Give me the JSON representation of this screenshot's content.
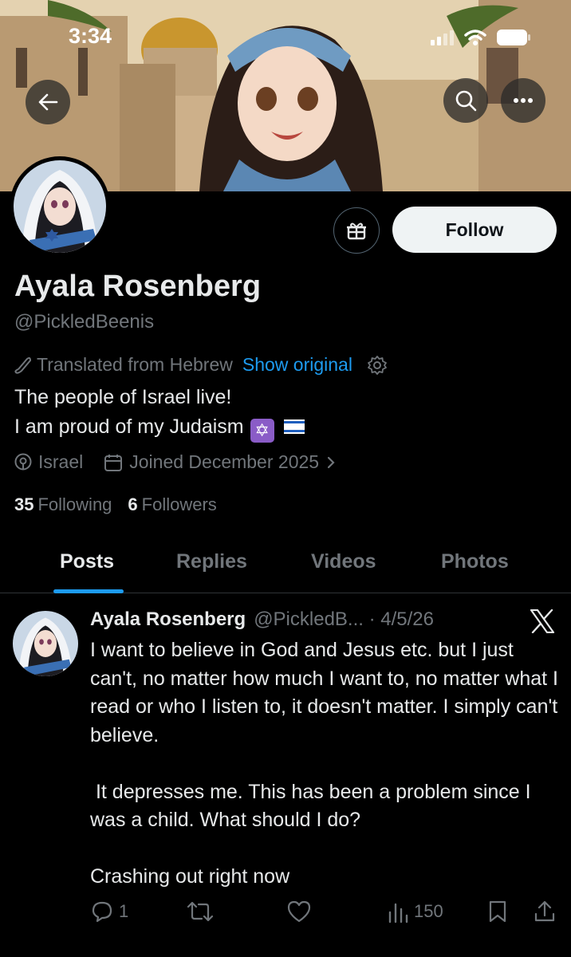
{
  "status_bar": {
    "time": "3:34"
  },
  "profile": {
    "display_name": "Ayala Rosenberg",
    "handle": "@PickledBeenis",
    "follow_label": "Follow",
    "translated_label": "Translated from Hebrew",
    "show_original_label": "Show original",
    "bio_line1": "The people of Israel live!",
    "bio_line2": "I am proud of my Judaism",
    "bio_star_emoji": "✡",
    "location": "Israel",
    "joined": "Joined December 2025",
    "following_count": "35",
    "following_label": "Following",
    "followers_count": "6",
    "followers_label": "Followers"
  },
  "tabs": [
    {
      "label": "Posts",
      "active": true
    },
    {
      "label": "Replies",
      "active": false
    },
    {
      "label": "Videos",
      "active": false
    },
    {
      "label": "Photos",
      "active": false
    }
  ],
  "post": {
    "author": "Ayala Rosenberg",
    "handle_date": "@PickledB... · 4/5/26",
    "paragraphs": [
      "I want to believe in God and Jesus etc. but I just can't, no matter how much I want to, no matter what I read or who I listen to, it doesn't matter. I simply can't believe.",
      " It depresses me. This has been a problem since I was a child. What should I do?",
      "Crashing out right now"
    ],
    "replies": "1",
    "views": "150"
  },
  "colors": {
    "accent": "#1d9bf0",
    "muted": "#71767b",
    "text": "#e7e9ea",
    "background": "#000000"
  },
  "icons": [
    "back-arrow-icon",
    "search-icon",
    "more-icon",
    "gift-icon",
    "translate-icon",
    "gear-icon",
    "location-icon",
    "calendar-icon",
    "chevron-right-icon",
    "x-logo-icon",
    "reply-icon",
    "repost-icon",
    "like-icon",
    "views-icon",
    "bookmark-icon",
    "share-icon"
  ]
}
